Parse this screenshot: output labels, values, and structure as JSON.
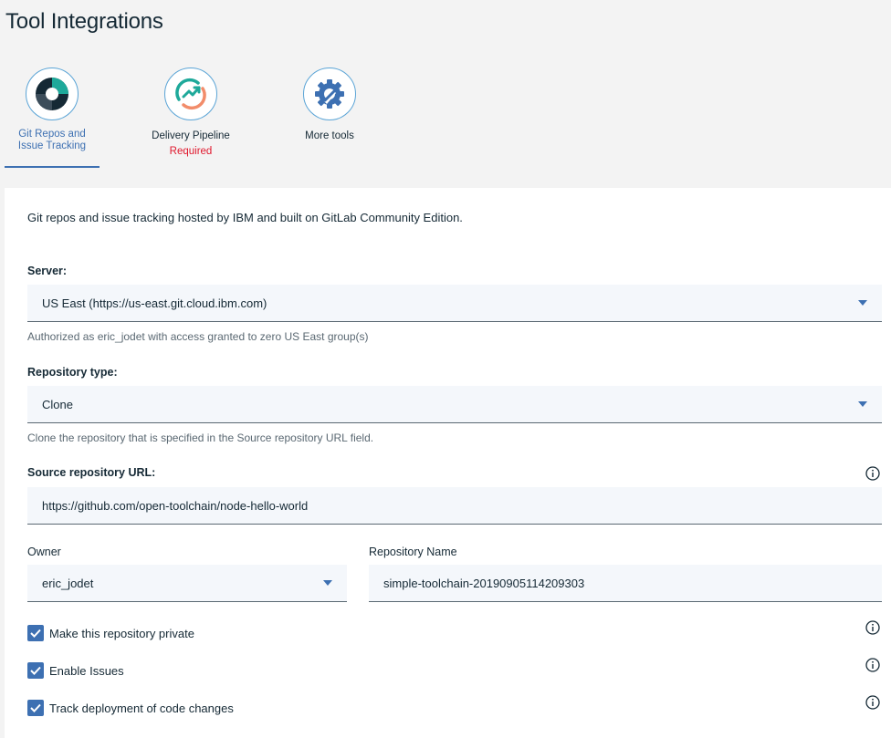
{
  "page": {
    "title": "Tool Integrations"
  },
  "tools": [
    {
      "label": "Git Repos and Issue Tracking",
      "active": true
    },
    {
      "label": "Delivery Pipeline",
      "status": "Required"
    },
    {
      "label": "More tools"
    }
  ],
  "panel": {
    "description": "Git repos and issue tracking hosted by IBM and built on GitLab Community Edition.",
    "server": {
      "label": "Server:",
      "value": "US East (https://us-east.git.cloud.ibm.com)",
      "helper": "Authorized as eric_jodet with access granted to zero US East group(s)"
    },
    "repo_type": {
      "label": "Repository type:",
      "value": "Clone",
      "helper": "Clone the repository that is specified in the Source repository URL field."
    },
    "source_url": {
      "label": "Source repository URL:",
      "value": "https://github.com/open-toolchain/node-hello-world"
    },
    "owner": {
      "label": "Owner",
      "value": "eric_jodet"
    },
    "repo_name": {
      "label": "Repository Name",
      "value": "simple-toolchain-20190905114209303"
    },
    "checkboxes": [
      {
        "label": "Make this repository private",
        "checked": true
      },
      {
        "label": "Enable Issues",
        "checked": true
      },
      {
        "label": "Track deployment of code changes",
        "checked": true
      }
    ]
  },
  "colors": {
    "accent": "#3d70b2",
    "required": "#e0182d",
    "field_bg": "#f4f7fb"
  }
}
